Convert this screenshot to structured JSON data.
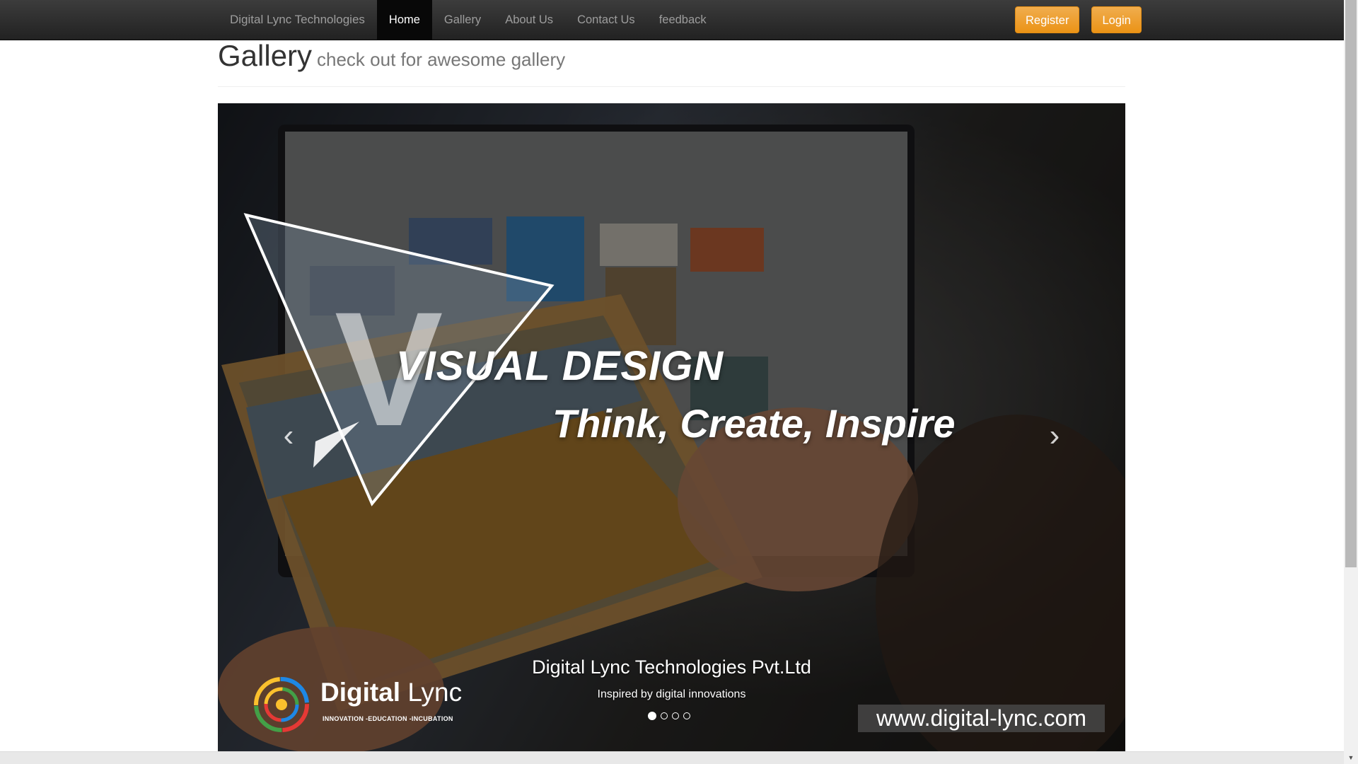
{
  "navbar": {
    "brand": "Digital Lync Technologies",
    "items": [
      {
        "label": "Home",
        "active": true
      },
      {
        "label": "Gallery",
        "active": false
      },
      {
        "label": "About Us",
        "active": false
      },
      {
        "label": "Contact Us",
        "active": false
      },
      {
        "label": "feedback",
        "active": false
      }
    ],
    "register_label": "Register",
    "login_label": "Login"
  },
  "header": {
    "title": "Gallery",
    "subtitle": "check out for awesome gallery"
  },
  "carousel": {
    "slide": {
      "headline": "VISUAL DESIGN",
      "tagline": "Think, Create, Inspire",
      "big_letter": "V",
      "logo_name_bold": "Digital",
      "logo_name_light": "Lync",
      "logo_tagline": "INNOVATION -EDUCATION -INCUBATION",
      "url": "www.digital-lync.com"
    },
    "caption_title": "Digital Lync Technologies Pvt.Ltd",
    "caption_text": "Inspired by digital innovations",
    "slide_count": 4,
    "active_index": 0
  },
  "colors": {
    "navbar": "#222222",
    "accent_warning": "#f0ad4e",
    "page_bg": "#ffffff"
  },
  "icons": [
    "chevron-left-icon",
    "chevron-right-icon",
    "digital-lync-logo-icon"
  ]
}
